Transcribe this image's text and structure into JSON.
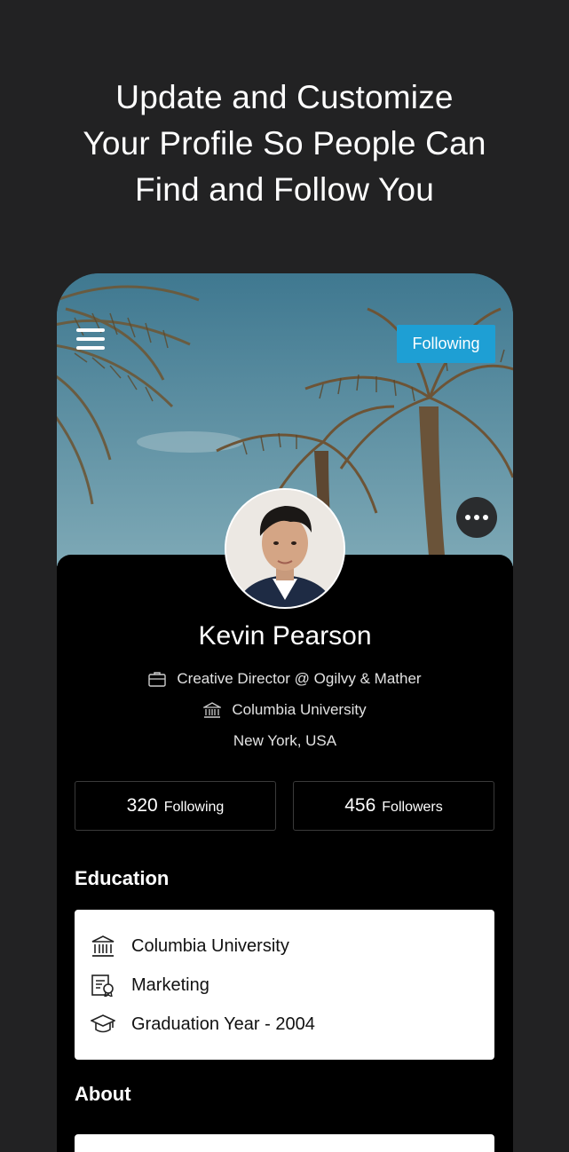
{
  "headline": {
    "line1": "Update and Customize",
    "line2": "Your Profile So People Can",
    "line3": "Find and Follow You"
  },
  "profile": {
    "follow_button": "Following",
    "name": "Kevin Pearson",
    "job": "Creative Director @ Ogilvy & Mather",
    "school": "Columbia University",
    "location": "New York, USA"
  },
  "stats": {
    "following_count": "320",
    "following_label": "Following",
    "followers_count": "456",
    "followers_label": "Followers"
  },
  "education": {
    "title": "Education",
    "items": [
      {
        "icon": "institution-icon",
        "text": "Columbia University"
      },
      {
        "icon": "certificate-icon",
        "text": "Marketing"
      },
      {
        "icon": "graduation-cap-icon",
        "text": "Graduation Year - 2004"
      }
    ]
  },
  "about": {
    "title": "About"
  },
  "colors": {
    "background": "#222223",
    "accent": "#1e9fd4",
    "panel": "#000000"
  }
}
